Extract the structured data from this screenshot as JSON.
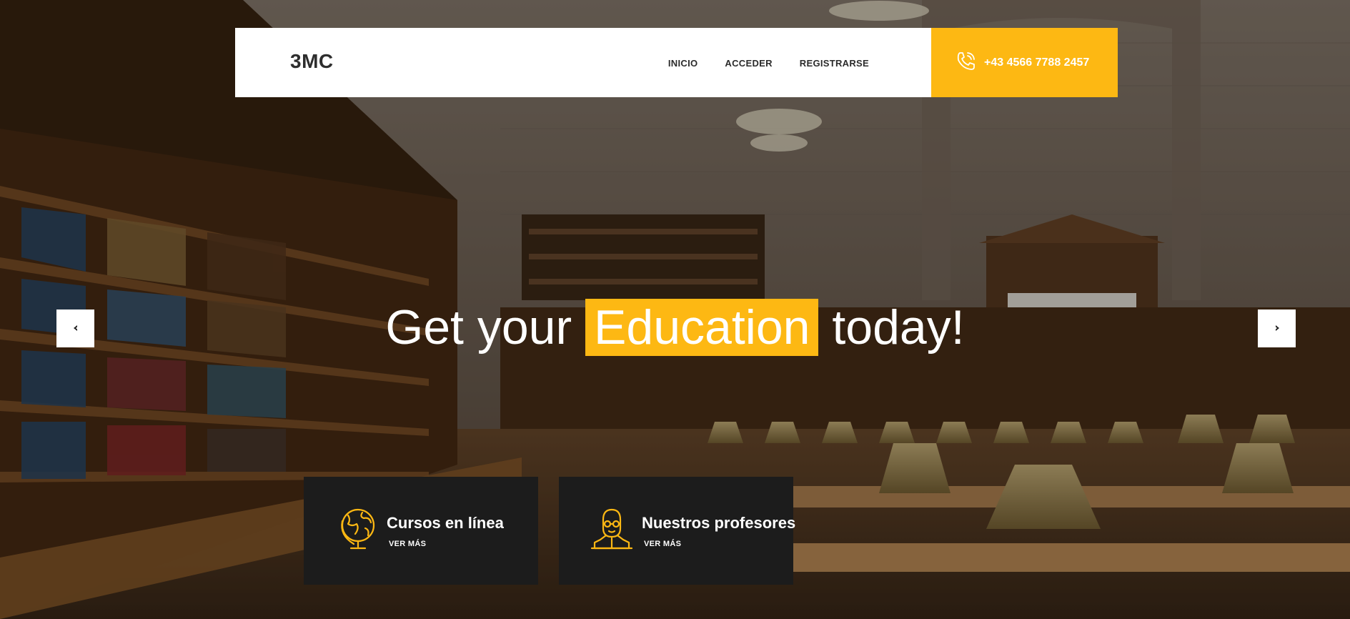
{
  "header": {
    "logo": "3MC",
    "nav": [
      {
        "label": "INICIO"
      },
      {
        "label": "ACCEDER"
      },
      {
        "label": "REGISTRARSE"
      }
    ],
    "phone": "+43 4566 7788 2457"
  },
  "hero": {
    "title_before": "Get your",
    "title_highlight": "Education",
    "title_after": "today!"
  },
  "cards": [
    {
      "title": "Cursos en línea",
      "link": "VER MÁS",
      "icon": "globe-icon"
    },
    {
      "title": "Nuestros profesores",
      "link": "VER MÁS",
      "icon": "teacher-icon"
    }
  ],
  "colors": {
    "accent": "#fdb813",
    "card_bg": "#1c1c1c",
    "header_bg": "#ffffff"
  }
}
